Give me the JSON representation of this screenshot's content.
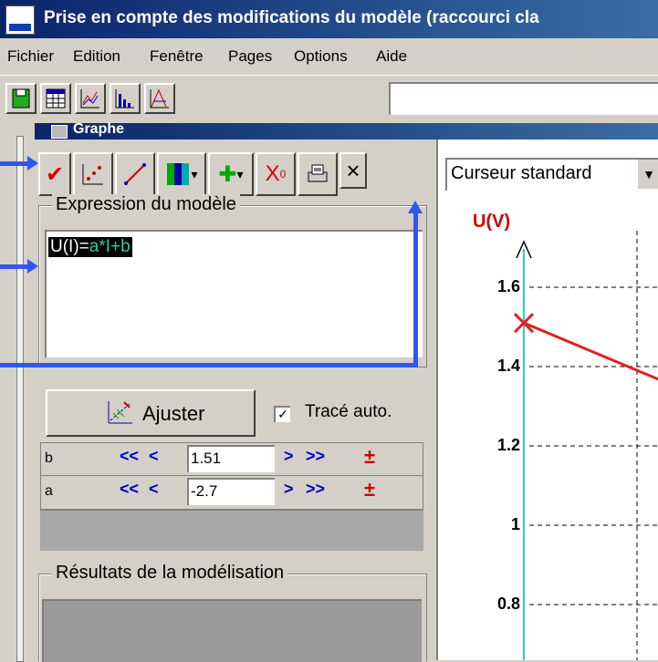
{
  "window": {
    "title": "Prise en compte des modifications du modèle (raccourci cla"
  },
  "menu": [
    "Fichier",
    "Edition",
    "Fenêtre",
    "Pages",
    "Options",
    "Aide"
  ],
  "toolbar_icons": [
    "save-icon",
    "table-icon",
    "graph-icon",
    "histogram-icon",
    "fft-icon"
  ],
  "graphe_window": {
    "title": "Graphe"
  },
  "model_toolbar": {
    "icons": [
      "check-icon",
      "points-icon",
      "line-icon",
      "color-dropdown-icon",
      "add-dropdown-icon",
      "x0-icon",
      "print-icon",
      "close-icon"
    ],
    "check": "✔",
    "x0": "X",
    "x0_sub": "0",
    "close": "×",
    "plus": "✚",
    "dropdown": "▾"
  },
  "expression": {
    "label": "Expression du modèle",
    "text_prefix": "U(I)=",
    "text_rest": "a*I+b"
  },
  "adjust": {
    "button_label": "Ajuster",
    "trace_label": "Tracé auto.",
    "trace_checked": "✓"
  },
  "params": [
    {
      "name": "b",
      "value": "1.51",
      "dec_fast": "<<",
      "dec": "<",
      "inc": ">",
      "inc_fast": ">>",
      "pm": "±"
    },
    {
      "name": "a",
      "value": "-2.7",
      "dec_fast": "<<",
      "dec": "<",
      "inc": ">",
      "inc_fast": ">>",
      "pm": "±"
    }
  ],
  "results": {
    "label": "Résultats de la modélisation"
  },
  "graph": {
    "cursor_mode": "Curseur standard",
    "y_label": "U(V)",
    "y_ticks": [
      "1.6",
      "1.4",
      "1.2",
      "1",
      "0.8"
    ],
    "axis_color": "#33cccc",
    "model_color": "#dd2222"
  },
  "chart_data": {
    "type": "line",
    "ylabel": "U(V)",
    "y_ticks": [
      1.6,
      1.4,
      1.2,
      1.0,
      0.8
    ],
    "series": [
      {
        "x": [
          0,
          0.05
        ],
        "y": [
          1.51,
          1.375
        ]
      }
    ]
  }
}
